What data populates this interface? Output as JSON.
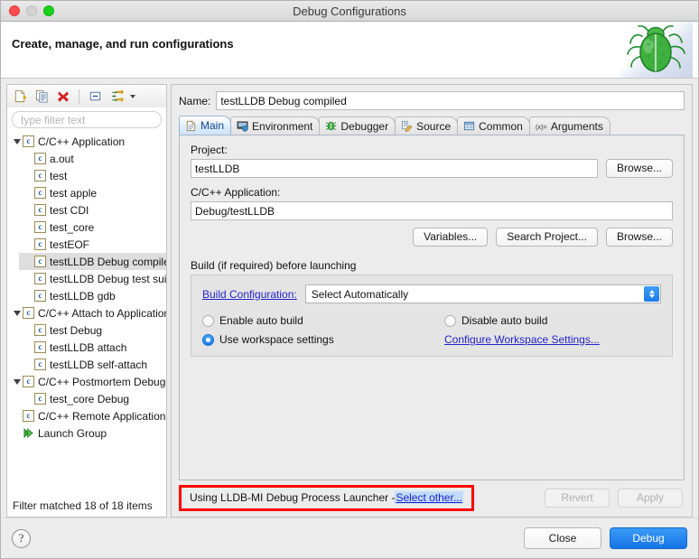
{
  "window": {
    "title": "Debug Configurations",
    "traffic_lights": [
      "close",
      "minimize",
      "zoom"
    ]
  },
  "header": {
    "title": "Create, manage, and run configurations",
    "icon": "green-bug-icon"
  },
  "tree_toolbar": {
    "buttons": [
      {
        "name": "new-launch-configuration",
        "icon": "new-document-icon"
      },
      {
        "name": "duplicate-launch-configuration",
        "icon": "copy-icon"
      },
      {
        "name": "delete-launch-configuration",
        "icon": "red-x-delete-icon"
      },
      {
        "name": "collapse-all",
        "icon": "collapse-all-icon"
      },
      {
        "name": "filter-launch-configurations",
        "icon": "filter-icon"
      }
    ]
  },
  "filter": {
    "placeholder": "type filter text",
    "value": ""
  },
  "tree": {
    "items": [
      {
        "label": "C/C++ Application",
        "level": 0,
        "icon": "c-file-icon",
        "expanded": true,
        "selected": false
      },
      {
        "label": "a.out",
        "level": 1,
        "icon": "c-file-icon",
        "expanded": null,
        "selected": false
      },
      {
        "label": "test",
        "level": 1,
        "icon": "c-file-icon",
        "expanded": null,
        "selected": false
      },
      {
        "label": "test apple",
        "level": 1,
        "icon": "c-file-icon",
        "expanded": null,
        "selected": false
      },
      {
        "label": "test CDI",
        "level": 1,
        "icon": "c-file-icon",
        "expanded": null,
        "selected": false
      },
      {
        "label": "test_core",
        "level": 1,
        "icon": "c-file-icon",
        "expanded": null,
        "selected": false
      },
      {
        "label": "testEOF",
        "level": 1,
        "icon": "c-file-icon",
        "expanded": null,
        "selected": false
      },
      {
        "label": "testLLDB Debug compiled",
        "level": 1,
        "icon": "c-file-icon",
        "expanded": null,
        "selected": true
      },
      {
        "label": "testLLDB Debug test suite",
        "level": 1,
        "icon": "c-file-icon",
        "expanded": null,
        "selected": false
      },
      {
        "label": "testLLDB gdb",
        "level": 1,
        "icon": "c-file-icon",
        "expanded": null,
        "selected": false
      },
      {
        "label": "C/C++ Attach to Application",
        "level": 0,
        "icon": "c-file-icon",
        "expanded": true,
        "selected": false
      },
      {
        "label": "test Debug",
        "level": 1,
        "icon": "c-file-icon",
        "expanded": null,
        "selected": false
      },
      {
        "label": "testLLDB attach",
        "level": 1,
        "icon": "c-file-icon",
        "expanded": null,
        "selected": false
      },
      {
        "label": "testLLDB self-attach",
        "level": 1,
        "icon": "c-file-icon",
        "expanded": null,
        "selected": false
      },
      {
        "label": "C/C++ Postmortem Debugger",
        "level": 0,
        "icon": "c-file-icon",
        "expanded": true,
        "selected": false
      },
      {
        "label": "test_core Debug",
        "level": 1,
        "icon": "c-file-icon",
        "expanded": null,
        "selected": false
      },
      {
        "label": "C/C++ Remote Application",
        "level": 0,
        "icon": "c-file-icon",
        "expanded": null,
        "selected": false
      },
      {
        "label": "Launch Group",
        "level": 0,
        "icon": "green-play-icon",
        "expanded": null,
        "selected": false
      }
    ],
    "status": "Filter matched 18 of 18 items"
  },
  "form": {
    "name_label": "Name:",
    "name_value": "testLLDB Debug compiled",
    "project_label": "Project:",
    "project_value": "testLLDB",
    "application_label": "C/C++ Application:",
    "application_value": "Debug/testLLDB",
    "browse_project_label": "Browse...",
    "variables_label": "Variables...",
    "search_project_label": "Search Project...",
    "browse_app_label": "Browse..."
  },
  "tabs": [
    {
      "label": "Main",
      "icon": "document-icon",
      "active": true
    },
    {
      "label": "Environment",
      "icon": "environment-icon",
      "active": false
    },
    {
      "label": "Debugger",
      "icon": "bug-icon",
      "active": false
    },
    {
      "label": "Source",
      "icon": "source-pencil-icon",
      "active": false
    },
    {
      "label": "Common",
      "icon": "table-icon",
      "active": false
    },
    {
      "label": "Arguments",
      "icon": "variable-icon",
      "active": false
    }
  ],
  "build_group": {
    "title": "Build (if required) before launching",
    "build_configuration_label": "Build Configuration:",
    "build_configuration_value": "Select Automatically",
    "enable_auto_build": {
      "label": "Enable auto build",
      "checked": false
    },
    "disable_auto_build": {
      "label": "Disable auto build",
      "checked": false
    },
    "use_workspace_settings": {
      "label": "Use workspace settings",
      "checked": true
    },
    "configure_workspace_link": "Configure Workspace Settings..."
  },
  "status_bar": {
    "text_prefix": "Using LLDB-MI Debug Process Launcher - ",
    "select_other_link": "Select other...",
    "revert_label": "Revert",
    "apply_label": "Apply",
    "highlight_color": "#ff0000"
  },
  "footer": {
    "help_label": "?",
    "close_label": "Close",
    "debug_label": "Debug",
    "debug_accent": "#1675e8"
  }
}
